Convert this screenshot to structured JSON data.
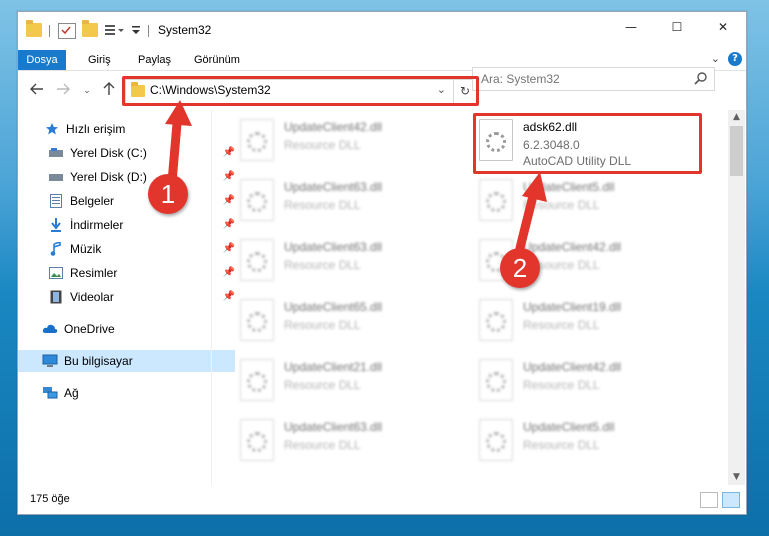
{
  "window": {
    "title": "System32",
    "controls": {
      "minimize": "—",
      "maximize": "☐",
      "close": "✕"
    }
  },
  "ribbon": {
    "tabs": [
      "Dosya",
      "Giriş",
      "Paylaş",
      "Görünüm"
    ],
    "help": "?"
  },
  "address": {
    "path": "C:\\Windows\\System32",
    "search_placeholder": "Ara: System32"
  },
  "nav": {
    "quick_access": "Hızlı erişim",
    "pinned": [
      {
        "label": "Yerel Disk (C:)",
        "icon": "drive-icon"
      },
      {
        "label": "Yerel Disk (D:)",
        "icon": "drive-icon"
      },
      {
        "label": "Belgeler",
        "icon": "documents-icon"
      },
      {
        "label": "İndirmeler",
        "icon": "downloads-icon"
      },
      {
        "label": "Müzik",
        "icon": "music-icon"
      },
      {
        "label": "Resimler",
        "icon": "pictures-icon"
      },
      {
        "label": "Videolar",
        "icon": "videos-icon"
      }
    ],
    "onedrive": "OneDrive",
    "this_pc": "Bu bilgisayar",
    "network": "Ağ"
  },
  "files": {
    "highlighted": {
      "name": "adsk62.dll",
      "version": "6.2.3048.0",
      "description": "AutoCAD Utility DLL"
    },
    "left_column": [
      {
        "name": "UpdateClient42.dll",
        "type": "Resource DLL"
      },
      {
        "name": "UpdateClient63.dll",
        "type": "Resource DLL"
      },
      {
        "name": "UpdateClient63.dll",
        "type": "Resource DLL"
      },
      {
        "name": "UpdateClient65.dll",
        "type": "Resource DLL"
      },
      {
        "name": "UpdateClient21.dll",
        "type": "Resource DLL"
      },
      {
        "name": "UpdateClient63.dll",
        "type": "Resource DLL"
      }
    ],
    "right_column": [
      {
        "name": "UpdateClient5.dll",
        "type": "Resource DLL"
      },
      {
        "name": "UpdateClient42.dll",
        "type": "Resource DLL"
      },
      {
        "name": "UpdateClient19.dll",
        "type": "Resource DLL"
      },
      {
        "name": "UpdateClient42.dll",
        "type": "Resource DLL"
      },
      {
        "name": "UpdateClient5.dll",
        "type": "Resource DLL"
      }
    ]
  },
  "status": {
    "item_count": "175 öğe"
  },
  "callouts": {
    "one": "1",
    "two": "2"
  },
  "colors": {
    "accent": "#1979ca",
    "highlight": "#e2352c",
    "selected": "#cce8ff"
  }
}
